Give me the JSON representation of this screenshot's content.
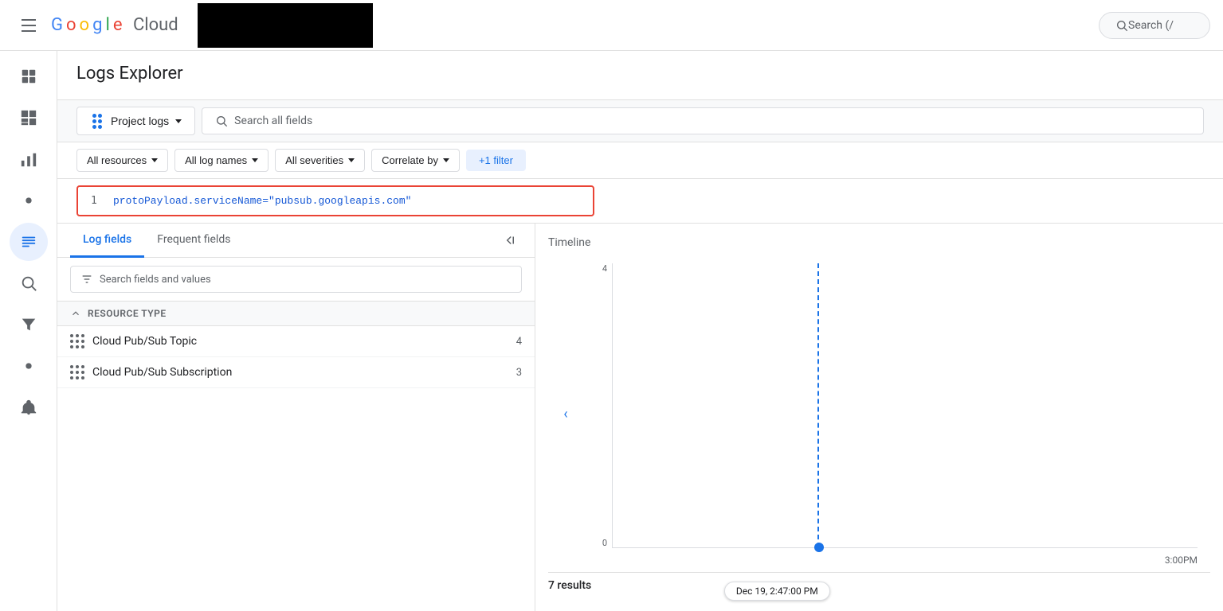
{
  "nav": {
    "search_label": "Search (/",
    "logo": {
      "g": "G",
      "o1": "o",
      "o2": "o",
      "g2": "g",
      "l": "l",
      "e": "e",
      "cloud": "Cloud"
    }
  },
  "page": {
    "title": "Logs Explorer"
  },
  "toolbar": {
    "project_logs_label": "Project logs",
    "search_placeholder": "Search all fields"
  },
  "filters": {
    "all_resources": "All resources",
    "all_log_names": "All log names",
    "all_severities": "All severities",
    "correlate_by": "Correlate by",
    "more_filter": "+1 filter"
  },
  "query": {
    "line_number": "1",
    "text": "protoPayload.serviceName=\"pubsub.googleapis.com\""
  },
  "left_panel": {
    "tab_log_fields": "Log fields",
    "tab_frequent_fields": "Frequent fields",
    "search_fields_placeholder": "Search fields and values",
    "resource_type_header": "RESOURCE TYPE",
    "resources": [
      {
        "name": "Cloud Pub/Sub Topic",
        "count": "4"
      },
      {
        "name": "Cloud Pub/Sub Subscription",
        "count": "3"
      }
    ]
  },
  "timeline": {
    "label": "Timeline",
    "y_max": "4",
    "y_min": "0",
    "tooltip_text": "Dec 19, 2:47:00 PM",
    "time_label": "3:00PM"
  },
  "results": {
    "count_label": "7 results"
  }
}
